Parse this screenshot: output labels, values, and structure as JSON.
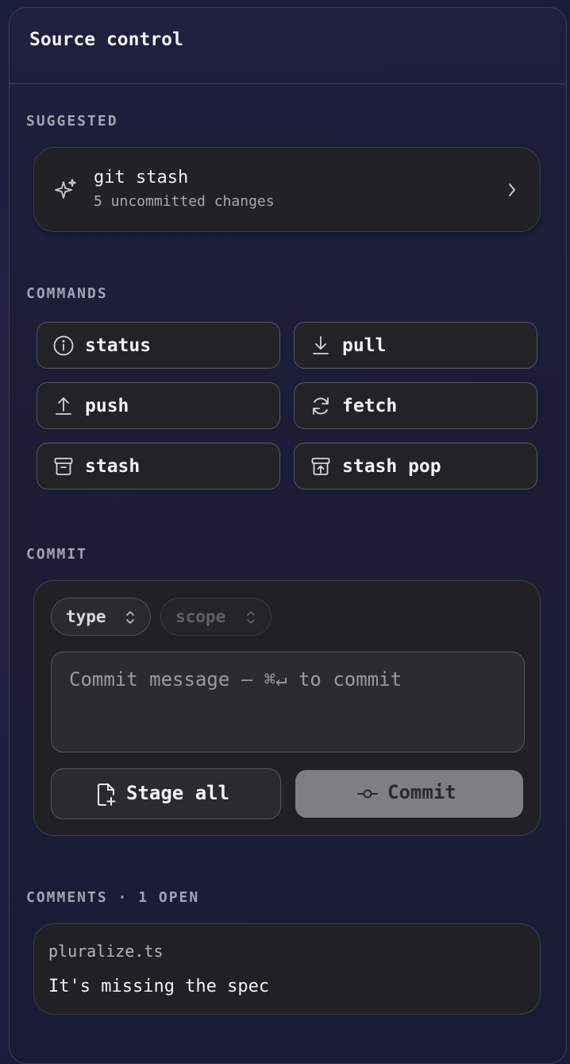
{
  "panel": {
    "title": "Source control"
  },
  "suggested": {
    "label": "SUGGESTED",
    "card": {
      "title": "git stash",
      "subtitle": "5 uncommitted changes",
      "icon": "sparkles-icon"
    }
  },
  "commands": {
    "label": "COMMANDS",
    "items": [
      {
        "label": "status",
        "icon": "info-icon"
      },
      {
        "label": "pull",
        "icon": "download-icon"
      },
      {
        "label": "push",
        "icon": "upload-icon"
      },
      {
        "label": "fetch",
        "icon": "refresh-icon"
      },
      {
        "label": "stash",
        "icon": "archive-icon"
      },
      {
        "label": "stash pop",
        "icon": "archive-up-icon"
      }
    ]
  },
  "commit": {
    "label": "COMMIT",
    "type_chip": "type",
    "scope_chip": "scope",
    "message_placeholder": "Commit message — ⌘↵ to commit",
    "stage_all_label": "Stage all",
    "commit_label": "Commit"
  },
  "comments": {
    "label": "COMMENTS · 1 OPEN",
    "items": [
      {
        "file": "pluralize.ts",
        "text": "It's missing the spec"
      }
    ]
  }
}
